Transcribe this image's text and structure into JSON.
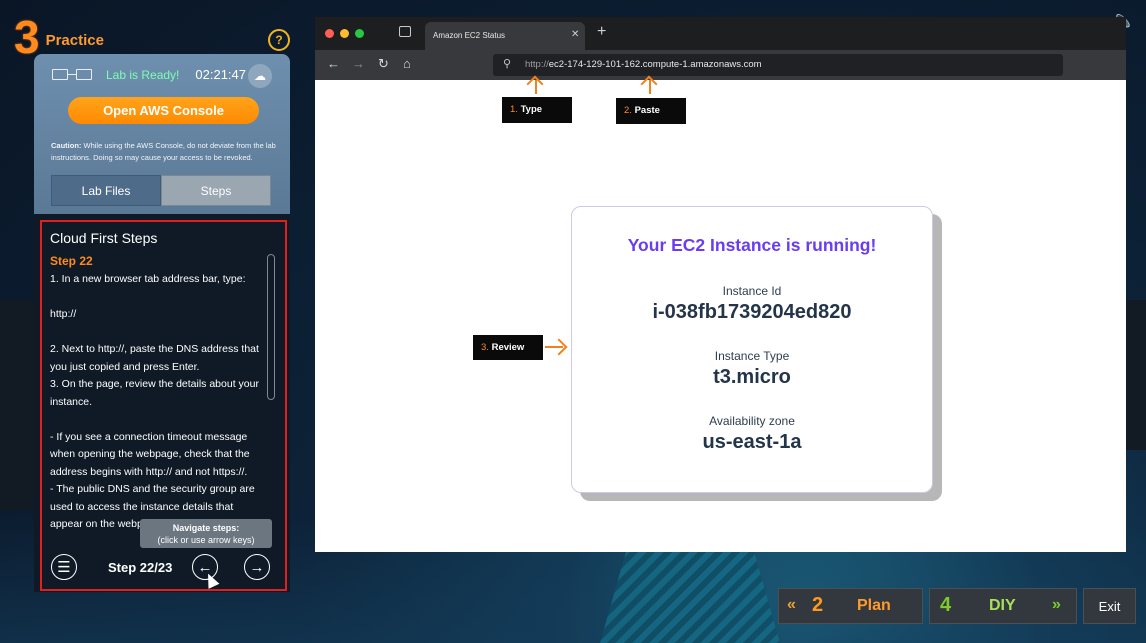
{
  "brand": {
    "number": "3",
    "label": "Practice",
    "help_icon": "?"
  },
  "lab": {
    "status": "Lab is Ready!",
    "timer": "02:21:47",
    "console_button": "Open AWS Console",
    "caution_bold": "Caution:",
    "caution_text": " While using the AWS Console, do not deviate from the lab instructions. Doing so may cause your access to be revoked.",
    "tabs": [
      "Lab Files",
      "Steps"
    ],
    "colors": {
      "ready": "#7dffb3",
      "accent": "#ff8a00"
    }
  },
  "steps": {
    "title": "Cloud First Steps",
    "step_label": "Step 22",
    "lines": [
      "1. In a new browser tab address bar, type:",
      "",
      "http://",
      "",
      "2. Next to http://, paste the DNS address that you just copied and press Enter.",
      "3. On the page, review the details about your instance.",
      "",
      "- If you see a connection timeout message when opening the webpage, check that the address begins with http:// and not https://.",
      "- The public DNS and the security group are used to access the instance details that appear on the webpage."
    ],
    "tooltip_title": "Navigate steps:",
    "tooltip_sub": "(click or use arrow keys)",
    "counter": "Step 22/23"
  },
  "browser": {
    "tab_title": "Amazon EC2 Status",
    "address_protocol": "http://",
    "address_host": "ec2-174-129-101-162.compute-1.amazonaws.com"
  },
  "annotations": {
    "type": {
      "num": "1.",
      "label": "Type"
    },
    "paste": {
      "num": "2.",
      "label": "Paste"
    },
    "review": {
      "num": "3.",
      "label": "Review"
    }
  },
  "card": {
    "title": "Your EC2 Instance is running!",
    "id_label": "Instance Id",
    "id_value": "i-038fb1739204ed820",
    "type_label": "Instance Type",
    "type_value": "t3.micro",
    "zone_label": "Availability zone",
    "zone_value": "us-east-1a"
  },
  "footer": {
    "plan_num": "2",
    "plan_label": "Plan",
    "diy_num": "4",
    "diy_label": "DIY",
    "exit_label": "Exit"
  }
}
